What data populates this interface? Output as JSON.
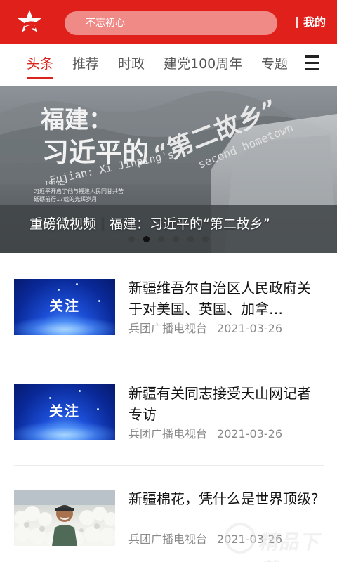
{
  "header": {
    "search_placeholder": "不忘初心",
    "mine_label": "我的",
    "brand_color": "#e0211b"
  },
  "tabs": [
    {
      "label": "头条",
      "active": true
    },
    {
      "label": "推荐",
      "active": false
    },
    {
      "label": "时政",
      "active": false
    },
    {
      "label": "建党100周年",
      "active": false
    },
    {
      "label": "专题",
      "active": false
    }
  ],
  "banner": {
    "caption": "重磅微视频｜福建：习近平的“第二故乡”",
    "slide_count": 6,
    "active_slide": 2,
    "image_text": {
      "title_line1": "福建：",
      "title_line2": "习近平的",
      "title_quote": "“第二故乡”",
      "english_line1": "Fujian: Xi Jinping's",
      "english_line2": "second hometown",
      "note_year": "1985年",
      "note_line1": "习近平开启了他与福建人民同甘共苦",
      "note_line2": "砥砺前行17载的光辉岁月"
    }
  },
  "news": [
    {
      "title": "新疆维吾尔自治区人民政府关于对美国、英国、加拿…",
      "source": "兵团广播电视台",
      "date": "2021-03-26",
      "thumb_type": "blue-guanzhu",
      "thumb_text": "关注"
    },
    {
      "title": "新疆有关同志接受天山网记者专访",
      "source": "兵团广播电视台",
      "date": "2021-03-26",
      "thumb_type": "blue-guanzhu",
      "thumb_text": "关注"
    },
    {
      "title": "新疆棉花，凭什么是世界顶级?",
      "source": "兵团广播电视台",
      "date": "2021-03-26",
      "thumb_type": "cotton-photo"
    }
  ],
  "watermark": {
    "text": "精品下载"
  },
  "icons": {
    "logo": "star-flag-logo-icon",
    "menu": "hamburger-menu-icon"
  }
}
